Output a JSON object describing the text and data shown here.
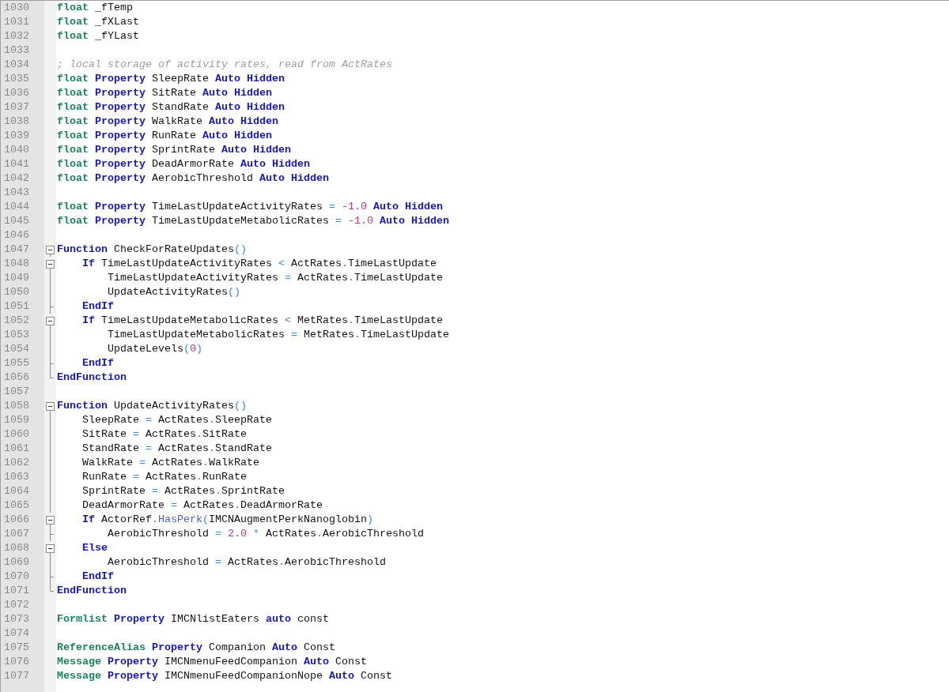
{
  "editor": {
    "lines": [
      {
        "number": "1030",
        "kind": "code",
        "tokens": [
          {
            "kind": "type",
            "text": "float"
          },
          {
            "kind": "plain",
            "text": " _fTemp"
          }
        ]
      },
      {
        "number": "1031",
        "kind": "code",
        "tokens": [
          {
            "kind": "type",
            "text": "float"
          },
          {
            "kind": "plain",
            "text": " _fXLast"
          }
        ]
      },
      {
        "number": "1032",
        "kind": "code",
        "tokens": [
          {
            "kind": "type",
            "text": "float"
          },
          {
            "kind": "plain",
            "text": " _fYLast"
          }
        ]
      },
      {
        "number": "1033",
        "kind": "code"
      },
      {
        "number": "1034",
        "kind": "code",
        "tokens": [
          {
            "kind": "comment",
            "text": "; local storage of activity rates, read from ActRates"
          }
        ]
      },
      {
        "number": "1035",
        "kind": "code",
        "tokens": [
          {
            "kind": "type",
            "text": "float"
          },
          {
            "kind": "keyword",
            "text": " Property"
          },
          {
            "kind": "plain",
            "text": " SleepRate"
          },
          {
            "kind": "keyword",
            "text": " Auto"
          },
          {
            "kind": "keyword",
            "text": " Hidden"
          }
        ]
      },
      {
        "number": "1036",
        "kind": "code",
        "tokens": [
          {
            "kind": "type",
            "text": "float"
          },
          {
            "kind": "keyword",
            "text": " Property"
          },
          {
            "kind": "plain",
            "text": " SitRate"
          },
          {
            "kind": "keyword",
            "text": " Auto"
          },
          {
            "kind": "keyword",
            "text": " Hidden"
          }
        ]
      },
      {
        "number": "1037",
        "kind": "code",
        "tokens": [
          {
            "kind": "type",
            "text": "float"
          },
          {
            "kind": "keyword",
            "text": " Property"
          },
          {
            "kind": "plain",
            "text": " StandRate"
          },
          {
            "kind": "keyword",
            "text": " Auto"
          },
          {
            "kind": "keyword",
            "text": " Hidden"
          }
        ]
      },
      {
        "number": "1038",
        "kind": "code",
        "tokens": [
          {
            "kind": "type",
            "text": "float"
          },
          {
            "kind": "keyword",
            "text": " Property"
          },
          {
            "kind": "plain",
            "text": " WalkRate"
          },
          {
            "kind": "keyword",
            "text": " Auto"
          },
          {
            "kind": "keyword",
            "text": " Hidden"
          }
        ]
      },
      {
        "number": "1039",
        "kind": "code",
        "tokens": [
          {
            "kind": "type",
            "text": "float"
          },
          {
            "kind": "keyword",
            "text": " Property"
          },
          {
            "kind": "plain",
            "text": " RunRate"
          },
          {
            "kind": "keyword",
            "text": " Auto"
          },
          {
            "kind": "keyword",
            "text": " Hidden"
          }
        ]
      },
      {
        "number": "1040",
        "kind": "code",
        "tokens": [
          {
            "kind": "type",
            "text": "float"
          },
          {
            "kind": "keyword",
            "text": " Property"
          },
          {
            "kind": "plain",
            "text": " SprintRate"
          },
          {
            "kind": "keyword",
            "text": " Auto"
          },
          {
            "kind": "keyword",
            "text": " Hidden"
          }
        ]
      },
      {
        "number": "1041",
        "kind": "code",
        "tokens": [
          {
            "kind": "type",
            "text": "float"
          },
          {
            "kind": "keyword",
            "text": " Property"
          },
          {
            "kind": "plain",
            "text": " DeadArmorRate"
          },
          {
            "kind": "keyword",
            "text": " Auto"
          },
          {
            "kind": "keyword",
            "text": " Hidden"
          }
        ]
      },
      {
        "number": "1042",
        "kind": "code",
        "tokens": [
          {
            "kind": "type",
            "text": "float"
          },
          {
            "kind": "keyword",
            "text": " Property"
          },
          {
            "kind": "plain",
            "text": " AerobicThreshold"
          },
          {
            "kind": "keyword",
            "text": " Auto"
          },
          {
            "kind": "keyword",
            "text": " Hidden"
          }
        ]
      },
      {
        "number": "1043",
        "kind": "code"
      },
      {
        "number": "1044",
        "kind": "code",
        "tokens": [
          {
            "kind": "type",
            "text": "float"
          },
          {
            "kind": "keyword",
            "text": " Property"
          },
          {
            "kind": "plain",
            "text": " TimeLastUpdateActivityRates"
          },
          {
            "kind": "operator",
            "text": " ="
          },
          {
            "kind": "number",
            "text": " -1.0"
          },
          {
            "kind": "keyword",
            "text": " Auto"
          },
          {
            "kind": "keyword",
            "text": " Hidden"
          }
        ]
      },
      {
        "number": "1045",
        "kind": "code",
        "tokens": [
          {
            "kind": "type",
            "text": "float"
          },
          {
            "kind": "keyword",
            "text": " Property"
          },
          {
            "kind": "plain",
            "text": " TimeLastUpdateMetabolicRates"
          },
          {
            "kind": "operator",
            "text": " ="
          },
          {
            "kind": "number",
            "text": " -1.0"
          },
          {
            "kind": "keyword",
            "text": " Auto"
          },
          {
            "kind": "keyword",
            "text": " Hidden"
          }
        ]
      },
      {
        "number": "1046",
        "kind": "code"
      },
      {
        "number": "1047",
        "kind": "fold_start",
        "tokens": [
          {
            "kind": "keyword",
            "text": "Function"
          },
          {
            "kind": "plain",
            "text": " CheckForRateUpdates"
          },
          {
            "kind": "operator",
            "text": "()"
          }
        ]
      },
      {
        "number": "1048",
        "kind": "fold_start",
        "tokens": [
          {
            "kind": "keyword",
            "text": "    If"
          },
          {
            "kind": "plain",
            "text": " TimeLastUpdateActivityRates"
          },
          {
            "kind": "operator",
            "text": " <"
          },
          {
            "kind": "plain",
            "text": " ActRates"
          },
          {
            "kind": "operator",
            "text": "."
          },
          {
            "kind": "plain",
            "text": "TimeLastUpdate"
          }
        ]
      },
      {
        "number": "1049",
        "kind": "fold_body",
        "tokens": [
          {
            "kind": "plain",
            "text": "        TimeLastUpdateActivityRates"
          },
          {
            "kind": "operator",
            "text": " ="
          },
          {
            "kind": "plain",
            "text": " ActRates"
          },
          {
            "kind": "operator",
            "text": "."
          },
          {
            "kind": "plain",
            "text": "TimeLastUpdate"
          }
        ]
      },
      {
        "number": "1050",
        "kind": "fold_body",
        "tokens": [
          {
            "kind": "plain",
            "text": "        UpdateActivityRates"
          },
          {
            "kind": "operator",
            "text": "()"
          }
        ]
      },
      {
        "number": "1051",
        "kind": "fold_branch",
        "tokens": [
          {
            "kind": "keyword",
            "text": "    EndIf"
          }
        ]
      },
      {
        "number": "1052",
        "kind": "fold_start",
        "tokens": [
          {
            "kind": "keyword",
            "text": "    If"
          },
          {
            "kind": "plain",
            "text": " TimeLastUpdateMetabolicRates"
          },
          {
            "kind": "operator",
            "text": " <"
          },
          {
            "kind": "plain",
            "text": " MetRates"
          },
          {
            "kind": "operator",
            "text": "."
          },
          {
            "kind": "plain",
            "text": "TimeLastUpdate"
          }
        ]
      },
      {
        "number": "1053",
        "kind": "fold_body",
        "tokens": [
          {
            "kind": "plain",
            "text": "        TimeLastUpdateMetabolicRates"
          },
          {
            "kind": "operator",
            "text": " ="
          },
          {
            "kind": "plain",
            "text": " MetRates"
          },
          {
            "kind": "operator",
            "text": "."
          },
          {
            "kind": "plain",
            "text": "TimeLastUpdate"
          }
        ]
      },
      {
        "number": "1054",
        "kind": "fold_body",
        "tokens": [
          {
            "kind": "plain",
            "text": "        UpdateLevels"
          },
          {
            "kind": "operator",
            "text": "("
          },
          {
            "kind": "number",
            "text": "0"
          },
          {
            "kind": "operator",
            "text": ")"
          }
        ]
      },
      {
        "number": "1055",
        "kind": "fold_branch",
        "tokens": [
          {
            "kind": "keyword",
            "text": "    EndIf"
          }
        ]
      },
      {
        "number": "1056",
        "kind": "fold_end",
        "tokens": [
          {
            "kind": "keyword",
            "text": "EndFunction"
          }
        ]
      },
      {
        "number": "1057",
        "kind": "code"
      },
      {
        "number": "1058",
        "kind": "fold_start",
        "tokens": [
          {
            "kind": "keyword",
            "text": "Function"
          },
          {
            "kind": "plain",
            "text": " UpdateActivityRates"
          },
          {
            "kind": "operator",
            "text": "()"
          }
        ]
      },
      {
        "number": "1059",
        "kind": "fold_body",
        "tokens": [
          {
            "kind": "plain",
            "text": "    SleepRate"
          },
          {
            "kind": "operator",
            "text": " ="
          },
          {
            "kind": "plain",
            "text": " ActRates"
          },
          {
            "kind": "operator",
            "text": "."
          },
          {
            "kind": "plain",
            "text": "SleepRate"
          }
        ]
      },
      {
        "number": "1060",
        "kind": "fold_body",
        "tokens": [
          {
            "kind": "plain",
            "text": "    SitRate"
          },
          {
            "kind": "operator",
            "text": " ="
          },
          {
            "kind": "plain",
            "text": " ActRates"
          },
          {
            "kind": "operator",
            "text": "."
          },
          {
            "kind": "plain",
            "text": "SitRate"
          }
        ]
      },
      {
        "number": "1061",
        "kind": "fold_body",
        "tokens": [
          {
            "kind": "plain",
            "text": "    StandRate"
          },
          {
            "kind": "operator",
            "text": " ="
          },
          {
            "kind": "plain",
            "text": " ActRates"
          },
          {
            "kind": "operator",
            "text": "."
          },
          {
            "kind": "plain",
            "text": "StandRate"
          }
        ]
      },
      {
        "number": "1062",
        "kind": "fold_body",
        "tokens": [
          {
            "kind": "plain",
            "text": "    WalkRate"
          },
          {
            "kind": "operator",
            "text": " ="
          },
          {
            "kind": "plain",
            "text": " ActRates"
          },
          {
            "kind": "operator",
            "text": "."
          },
          {
            "kind": "plain",
            "text": "WalkRate"
          }
        ]
      },
      {
        "number": "1063",
        "kind": "fold_body",
        "tokens": [
          {
            "kind": "plain",
            "text": "    RunRate"
          },
          {
            "kind": "operator",
            "text": " ="
          },
          {
            "kind": "plain",
            "text": " ActRates"
          },
          {
            "kind": "operator",
            "text": "."
          },
          {
            "kind": "plain",
            "text": "RunRate"
          }
        ]
      },
      {
        "number": "1064",
        "kind": "fold_body",
        "tokens": [
          {
            "kind": "plain",
            "text": "    SprintRate"
          },
          {
            "kind": "operator",
            "text": " ="
          },
          {
            "kind": "plain",
            "text": " ActRates"
          },
          {
            "kind": "operator",
            "text": "."
          },
          {
            "kind": "plain",
            "text": "SprintRate"
          }
        ]
      },
      {
        "number": "1065",
        "kind": "fold_body",
        "tokens": [
          {
            "kind": "plain",
            "text": "    DeadArmorRate"
          },
          {
            "kind": "operator",
            "text": " ="
          },
          {
            "kind": "plain",
            "text": " ActRates"
          },
          {
            "kind": "operator",
            "text": "."
          },
          {
            "kind": "plain",
            "text": "DeadArmorRate"
          }
        ]
      },
      {
        "number": "1066",
        "kind": "fold_start",
        "tokens": [
          {
            "kind": "keyword",
            "text": "    If"
          },
          {
            "kind": "plain",
            "text": " ActorRef"
          },
          {
            "kind": "operator",
            "text": "."
          },
          {
            "kind": "method",
            "text": "HasPerk"
          },
          {
            "kind": "operator",
            "text": "("
          },
          {
            "kind": "plain",
            "text": "IMCNAugmentPerkNanoglobin"
          },
          {
            "kind": "operator",
            "text": ")"
          }
        ]
      },
      {
        "number": "1067",
        "kind": "fold_branch",
        "tokens": [
          {
            "kind": "plain",
            "text": "        AerobicThreshold"
          },
          {
            "kind": "operator",
            "text": " ="
          },
          {
            "kind": "number",
            "text": " 2.0"
          },
          {
            "kind": "operator",
            "text": " *"
          },
          {
            "kind": "plain",
            "text": " ActRates"
          },
          {
            "kind": "operator",
            "text": "."
          },
          {
            "kind": "plain",
            "text": "AerobicThreshold"
          }
        ]
      },
      {
        "number": "1068",
        "kind": "fold_start",
        "tokens": [
          {
            "kind": "keyword",
            "text": "    Else"
          }
        ]
      },
      {
        "number": "1069",
        "kind": "fold_body",
        "tokens": [
          {
            "kind": "plain",
            "text": "        AerobicThreshold"
          },
          {
            "kind": "operator",
            "text": " ="
          },
          {
            "kind": "plain",
            "text": " ActRates"
          },
          {
            "kind": "operator",
            "text": "."
          },
          {
            "kind": "plain",
            "text": "AerobicThreshold"
          }
        ]
      },
      {
        "number": "1070",
        "kind": "fold_branch",
        "tokens": [
          {
            "kind": "keyword",
            "text": "    EndIf"
          }
        ]
      },
      {
        "number": "1071",
        "kind": "fold_end",
        "tokens": [
          {
            "kind": "keyword",
            "text": "EndFunction"
          }
        ]
      },
      {
        "number": "1072",
        "kind": "code"
      },
      {
        "number": "1073",
        "kind": "code",
        "tokens": [
          {
            "kind": "type",
            "text": "Formlist"
          },
          {
            "kind": "keyword",
            "text": " Property"
          },
          {
            "kind": "plain",
            "text": " IMCNlistEaters"
          },
          {
            "kind": "keyword",
            "text": " auto"
          },
          {
            "kind": "plain",
            "text": " const"
          }
        ]
      },
      {
        "number": "1074",
        "kind": "code"
      },
      {
        "number": "1075",
        "kind": "code",
        "tokens": [
          {
            "kind": "type",
            "text": "ReferenceAlias"
          },
          {
            "kind": "keyword",
            "text": " Property"
          },
          {
            "kind": "plain",
            "text": " Companion"
          },
          {
            "kind": "keyword",
            "text": " Auto"
          },
          {
            "kind": "plain",
            "text": " Const"
          }
        ]
      },
      {
        "number": "1076",
        "kind": "code",
        "tokens": [
          {
            "kind": "type",
            "text": "Message"
          },
          {
            "kind": "keyword",
            "text": " Property"
          },
          {
            "kind": "plain",
            "text": " IMCNmenuFeedCompanion"
          },
          {
            "kind": "keyword",
            "text": " Auto"
          },
          {
            "kind": "plain",
            "text": " Const"
          }
        ]
      },
      {
        "number": "1077",
        "kind": "code",
        "tokens": [
          {
            "kind": "type",
            "text": "Message"
          },
          {
            "kind": "keyword",
            "text": " Property"
          },
          {
            "kind": "plain",
            "text": " IMCNmenuFeedCompanionNope"
          },
          {
            "kind": "keyword",
            "text": " Auto"
          },
          {
            "kind": "plain",
            "text": " Const"
          }
        ]
      }
    ]
  }
}
